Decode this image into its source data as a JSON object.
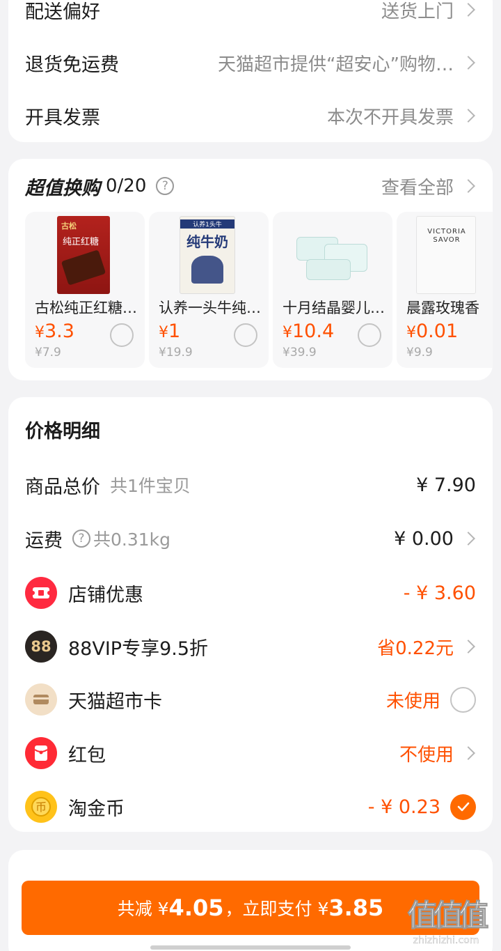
{
  "options": [
    {
      "label": "配送偏好",
      "value": "送货上门"
    },
    {
      "label": "退货免运费",
      "value": "天猫超市提供“超安心”购物…"
    },
    {
      "label": "开具发票",
      "value": "本次不开具发票"
    }
  ],
  "swap": {
    "title": "超值换购",
    "count": "0/20",
    "help": "?",
    "view_all": "查看全部",
    "products": [
      {
        "name": "古松纯正红糖…",
        "yen": "¥",
        "price": "3.3",
        "orig": "¥7.9",
        "pack_text": "古松",
        "pack_sub": "纯正红糖"
      },
      {
        "name": "认养一头牛纯…",
        "yen": "¥",
        "price": "1",
        "orig": "¥19.9",
        "pack_text": "纯牛奶",
        "pack_top": "认养1头牛"
      },
      {
        "name": "十月结晶婴儿…",
        "yen": "¥",
        "price": "10.4",
        "orig": "¥39.9"
      },
      {
        "name": "晨露玫瑰香",
        "yen": "¥",
        "price": "0.01",
        "orig": "¥9.9",
        "pack_text": "VICTORIA SAVOR"
      }
    ]
  },
  "price": {
    "title": "价格明细",
    "total_label": "商品总价",
    "total_sub": "共1件宝贝",
    "total_value": "¥ 7.90",
    "shipping_label": "运费",
    "shipping_help": "?",
    "shipping_sub": "共0.31kg",
    "shipping_value": "¥ 0.00",
    "store_label": "店铺优惠",
    "store_value": "- ¥ 3.60",
    "vip_badge": "88",
    "vip_label": "88VIP专享9.5折",
    "vip_value": "省0.22元",
    "card_label": "天猫超市卡",
    "card_value": "未使用",
    "redpack_label": "红包",
    "redpack_value": "不使用",
    "coin_label": "淘金币",
    "coin_value": "- ¥ 0.23"
  },
  "pay": {
    "prefix": "共减 ¥",
    "reduce": "4.05",
    "middle": "，立即支付 ¥",
    "amount": "3.85"
  },
  "watermark": {
    "glyphs": "值值值",
    "url": "zhizhizhi.com"
  },
  "colors": {
    "accent": "#ff5000",
    "button": "#ff6a00",
    "background": "#f3f3f5"
  }
}
